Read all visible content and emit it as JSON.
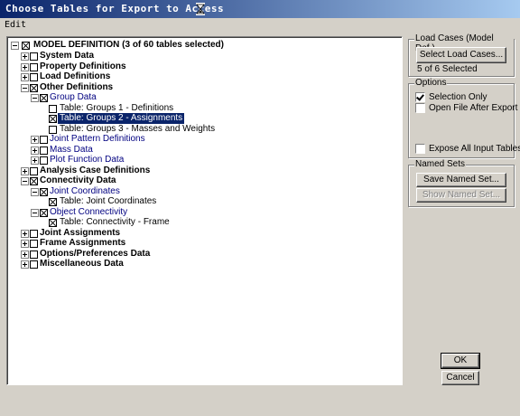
{
  "window": {
    "title": "Choose Tables for Export to Access"
  },
  "menu": {
    "edit": "Edit"
  },
  "tree": {
    "root": "MODEL DEFINITION   (3 of 60 tables selected)",
    "items": [
      {
        "label": "System Data",
        "checked": false
      },
      {
        "label": "Property Definitions",
        "checked": false
      },
      {
        "label": "Load Definitions",
        "checked": false
      },
      {
        "label": "Other Definitions",
        "checked": true
      },
      {
        "label": "Group Data",
        "checked": true
      },
      {
        "label": "Table:  Groups 1 - Definitions",
        "checked": false
      },
      {
        "label": "Table:  Groups 2 - Assignments",
        "checked": true,
        "selected": true
      },
      {
        "label": "Table:  Groups 3 - Masses and Weights",
        "checked": false
      },
      {
        "label": "Joint Pattern Definitions",
        "checked": false
      },
      {
        "label": "Mass Data",
        "checked": false
      },
      {
        "label": "Plot Function Data",
        "checked": false
      },
      {
        "label": "Analysis Case Definitions",
        "checked": false
      },
      {
        "label": "Connectivity Data",
        "checked": true
      },
      {
        "label": "Joint Coordinates",
        "checked": true
      },
      {
        "label": "Table:  Joint Coordinates",
        "checked": true
      },
      {
        "label": "Object Connectivity",
        "checked": true
      },
      {
        "label": "Table:  Connectivity - Frame",
        "checked": true
      },
      {
        "label": "Joint Assignments",
        "checked": false
      },
      {
        "label": "Frame Assignments",
        "checked": false
      },
      {
        "label": "Options/Preferences Data",
        "checked": false
      },
      {
        "label": "Miscellaneous Data",
        "checked": false
      }
    ]
  },
  "load_cases": {
    "title": "Load Cases (Model Def.)",
    "select_button": "Select Load Cases...",
    "status": "5 of 6 Selected"
  },
  "options": {
    "title": "Options",
    "selection_only": "Selection Only",
    "selection_only_checked": true,
    "open_file": "Open File After Export",
    "open_file_checked": false,
    "expose_all": "Expose All Input Tables",
    "expose_all_checked": false
  },
  "named_sets": {
    "title": "Named Sets",
    "save_button": "Save Named Set...",
    "show_button": "Show Named Set..."
  },
  "buttons": {
    "ok": "OK",
    "cancel": "Cancel"
  }
}
